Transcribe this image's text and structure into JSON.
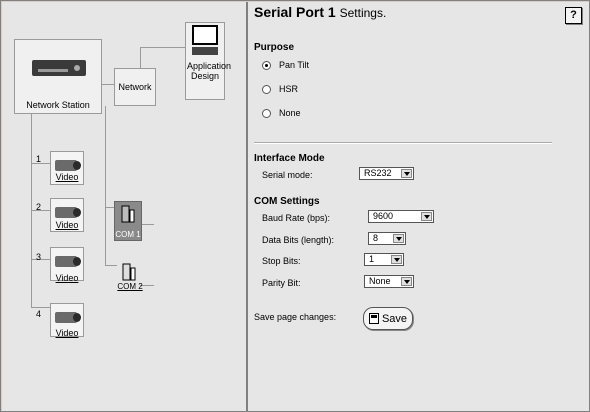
{
  "tree": {
    "network_station": {
      "label": "Network Station"
    },
    "network": {
      "label": "Network"
    },
    "application_design": {
      "label": "Application Design"
    },
    "videos": [
      {
        "number": "1",
        "label": "Video"
      },
      {
        "number": "2",
        "label": "Video"
      },
      {
        "number": "3",
        "label": "Video"
      },
      {
        "number": "4",
        "label": "Video"
      }
    ],
    "com_ports": [
      {
        "label": "COM 1",
        "selected": true
      },
      {
        "label": "COM 2",
        "selected": false
      }
    ]
  },
  "settings": {
    "title_strong": "Serial Port 1",
    "title_rest": "Settings.",
    "help_label": "?",
    "purpose": {
      "heading": "Purpose",
      "options": [
        {
          "label": "Pan Tilt",
          "checked": true
        },
        {
          "label": "HSR",
          "checked": false
        },
        {
          "label": "None",
          "checked": false
        }
      ]
    },
    "interface_mode": {
      "heading": "Interface Mode",
      "serial_mode_label": "Serial mode:",
      "serial_mode_value": "RS232"
    },
    "com_settings": {
      "heading": "COM Settings",
      "fields": [
        {
          "label": "Baud Rate (bps):",
          "value": "9600"
        },
        {
          "label": "Data Bits (length):",
          "value": "8"
        },
        {
          "label": "Stop Bits:",
          "value": "1"
        },
        {
          "label": "Parity Bit:",
          "value": "None"
        }
      ]
    },
    "save": {
      "prompt": "Save page changes:",
      "button_label": "Save"
    }
  }
}
